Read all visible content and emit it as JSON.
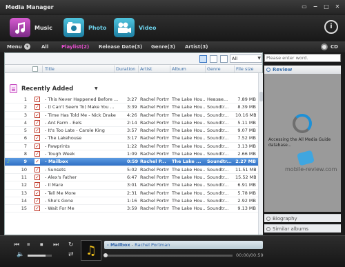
{
  "window": {
    "title": "Media Manager"
  },
  "media_tabs": [
    {
      "label": "Music",
      "active": true
    },
    {
      "label": "Photo",
      "active": false
    },
    {
      "label": "Video",
      "active": false
    }
  ],
  "filter_bar": {
    "menu": "Menu",
    "items": [
      "All",
      "Playlist(2)",
      "Release Date(3)",
      "Genre(3)",
      "Artist(3)"
    ],
    "selected": "Playlist(2)",
    "cd": "CD"
  },
  "toolbar": {
    "select_value": "All"
  },
  "columns": [
    "Title",
    "Duration",
    "Artist",
    "Album",
    "Genre",
    "File size"
  ],
  "group": {
    "title": "Recently Added"
  },
  "tracks": [
    {
      "num": "1",
      "title": "- This Never Happened Before ...",
      "duration": "3:27",
      "artist": "Rachel Portm...",
      "album": "The Lake Hou...",
      "genre": "Hевзвe...",
      "size": "7.89 MB"
    },
    {
      "num": "2",
      "title": "- (I Can't Seem To) Make You ...",
      "duration": "3:39",
      "artist": "Rachel Portm...",
      "album": "The Lake Hou...",
      "genre": "Soundtr...",
      "size": "8.39 MB"
    },
    {
      "num": "3",
      "title": "- Time Has Told Me - Nick Drake",
      "duration": "4:26",
      "artist": "Rachel Portm...",
      "album": "The Lake Hou...",
      "genre": "Soundtr...",
      "size": "10.16 MB"
    },
    {
      "num": "4",
      "title": "- Ant Farm - Eels",
      "duration": "2:14",
      "artist": "Rachel Portm...",
      "album": "The Lake Hou...",
      "genre": "Soundtr...",
      "size": "5.11 MB"
    },
    {
      "num": "5",
      "title": "- It's Too Late - Carole King",
      "duration": "3:57",
      "artist": "Rachel Portm...",
      "album": "The Lake Hou...",
      "genre": "Soundtr...",
      "size": "9.07 MB"
    },
    {
      "num": "6",
      "title": "- The Lakehouse",
      "duration": "3:17",
      "artist": "Rachel Portm...",
      "album": "The Lake Hou...",
      "genre": "Soundtr...",
      "size": "7.52 MB"
    },
    {
      "num": "7",
      "title": "- Pawprints",
      "duration": "1:22",
      "artist": "Rachel Portm...",
      "album": "The Lake Hou...",
      "genre": "Soundtr...",
      "size": "3.13 MB"
    },
    {
      "num": "8",
      "title": "- Tough Week",
      "duration": "1:09",
      "artist": "Rachel Portm...",
      "album": "The Lake Hou...",
      "genre": "Soundtr...",
      "size": "2.66 MB"
    },
    {
      "num": "9",
      "title": "- Mailbox",
      "duration": "0:59",
      "artist": "Rachel P...",
      "album": "The Lake ...",
      "genre": "Soundtr...",
      "size": "2.27 MB",
      "selected": true
    },
    {
      "num": "10",
      "title": "- Sunsets",
      "duration": "5:02",
      "artist": "Rachel Portm...",
      "album": "The Lake Hou...",
      "genre": "Soundtr...",
      "size": "11.51 MB"
    },
    {
      "num": "11",
      "title": "- Alex's Father",
      "duration": "6:47",
      "artist": "Rachel Portm...",
      "album": "The Lake Hou...",
      "genre": "Soundtr...",
      "size": "15.52 MB"
    },
    {
      "num": "12",
      "title": "- Il Mare",
      "duration": "3:01",
      "artist": "Rachel Portm...",
      "album": "The Lake Hou...",
      "genre": "Soundtr...",
      "size": "6.91 MB"
    },
    {
      "num": "13",
      "title": "- Tell Me More",
      "duration": "2:31",
      "artist": "Rachel Portm...",
      "album": "The Lake Hou...",
      "genre": "Soundtr...",
      "size": "5.78 MB"
    },
    {
      "num": "14",
      "title": "- She's Gone",
      "duration": "1:16",
      "artist": "Rachel Portm...",
      "album": "The Lake Hou...",
      "genre": "Soundtr...",
      "size": "2.92 MB"
    },
    {
      "num": "15",
      "title": "- Wait For Me",
      "duration": "3:59",
      "artist": "Rachel Portm...",
      "album": "The Lake Hou...",
      "genre": "Soundtr...",
      "size": "9.13 MB"
    }
  ],
  "right_panel": {
    "search_placeholder": "Please enter word.",
    "review": "Review",
    "accessing": "Accessing the All Media Guide database...",
    "watermark": "mobile-review.com",
    "biography": "Biography",
    "similar": "Similar albums"
  },
  "player": {
    "song": "- Mailbox",
    "separator": "-",
    "artist": "Rachel Portman",
    "time": "00:00/00:59",
    "progress_fraction": 0.0,
    "volume_fraction": 0.75
  },
  "colors": {
    "accent_pink": "#e84fd0",
    "selection_blue": "#2f6fc5",
    "check_red": "#c03a2b"
  }
}
